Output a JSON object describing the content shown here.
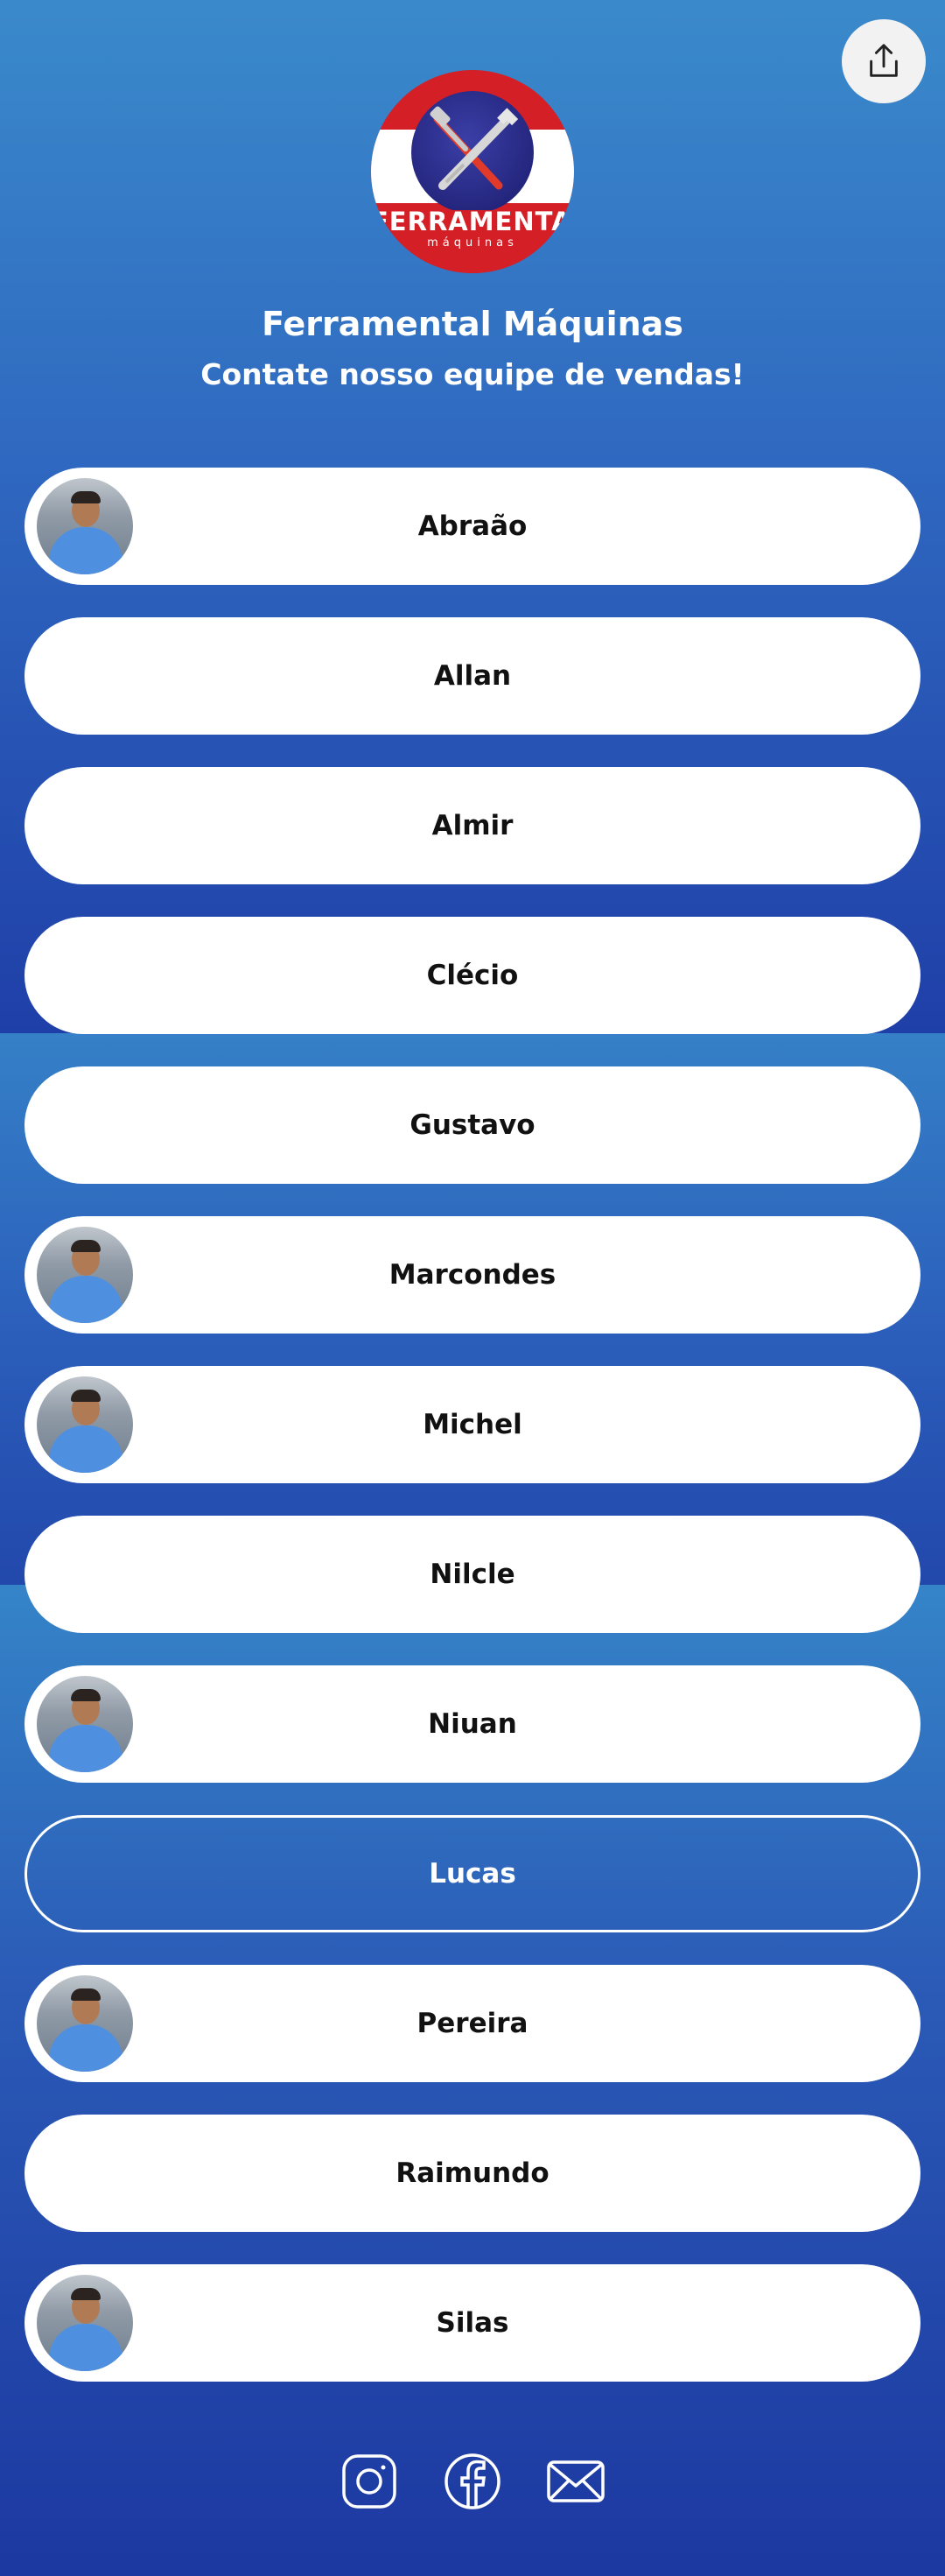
{
  "header": {
    "share_icon": "share-icon",
    "logo": {
      "brand": "FERRAMENTAL",
      "sub": "máquinas"
    },
    "title": "Ferramental Máquinas",
    "subtitle": "Contate nosso equipe de vendas!"
  },
  "contacts": [
    {
      "label": "Abraão",
      "avatar": true
    },
    {
      "label": "Allan",
      "avatar": false
    },
    {
      "label": "Almir",
      "avatar": false
    },
    {
      "label": "Clécio",
      "avatar": false
    },
    {
      "label": "Gustavo",
      "avatar": false
    },
    {
      "label": "Marcondes",
      "avatar": true
    },
    {
      "label": "Michel",
      "avatar": true
    },
    {
      "label": "Nilcle",
      "avatar": false
    },
    {
      "label": "Niuan",
      "avatar": true
    },
    {
      "label": "Lucas",
      "avatar": false,
      "style": "outline"
    },
    {
      "label": "Pereira",
      "avatar": true
    },
    {
      "label": "Raimundo",
      "avatar": false
    },
    {
      "label": "Silas",
      "avatar": true
    }
  ],
  "footer": {
    "icons": [
      "instagram-icon",
      "facebook-icon",
      "mail-icon"
    ]
  },
  "colors": {
    "background_top": "#3a8acb",
    "background_bottom": "#1c38a1",
    "button": "#ffffff",
    "logo_red": "#d41f26",
    "logo_navy": "#24267e"
  }
}
